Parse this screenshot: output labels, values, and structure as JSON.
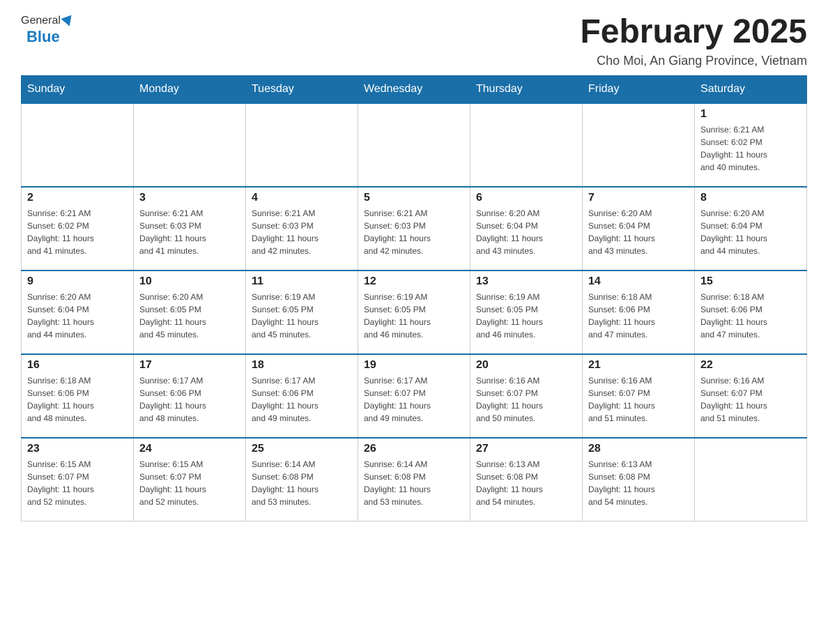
{
  "header": {
    "logo_general": "General",
    "logo_blue": "Blue",
    "month_title": "February 2025",
    "location": "Cho Moi, An Giang Province, Vietnam"
  },
  "days_of_week": [
    "Sunday",
    "Monday",
    "Tuesday",
    "Wednesday",
    "Thursday",
    "Friday",
    "Saturday"
  ],
  "weeks": [
    [
      {
        "day": "",
        "info": ""
      },
      {
        "day": "",
        "info": ""
      },
      {
        "day": "",
        "info": ""
      },
      {
        "day": "",
        "info": ""
      },
      {
        "day": "",
        "info": ""
      },
      {
        "day": "",
        "info": ""
      },
      {
        "day": "1",
        "info": "Sunrise: 6:21 AM\nSunset: 6:02 PM\nDaylight: 11 hours\nand 40 minutes."
      }
    ],
    [
      {
        "day": "2",
        "info": "Sunrise: 6:21 AM\nSunset: 6:02 PM\nDaylight: 11 hours\nand 41 minutes."
      },
      {
        "day": "3",
        "info": "Sunrise: 6:21 AM\nSunset: 6:03 PM\nDaylight: 11 hours\nand 41 minutes."
      },
      {
        "day": "4",
        "info": "Sunrise: 6:21 AM\nSunset: 6:03 PM\nDaylight: 11 hours\nand 42 minutes."
      },
      {
        "day": "5",
        "info": "Sunrise: 6:21 AM\nSunset: 6:03 PM\nDaylight: 11 hours\nand 42 minutes."
      },
      {
        "day": "6",
        "info": "Sunrise: 6:20 AM\nSunset: 6:04 PM\nDaylight: 11 hours\nand 43 minutes."
      },
      {
        "day": "7",
        "info": "Sunrise: 6:20 AM\nSunset: 6:04 PM\nDaylight: 11 hours\nand 43 minutes."
      },
      {
        "day": "8",
        "info": "Sunrise: 6:20 AM\nSunset: 6:04 PM\nDaylight: 11 hours\nand 44 minutes."
      }
    ],
    [
      {
        "day": "9",
        "info": "Sunrise: 6:20 AM\nSunset: 6:04 PM\nDaylight: 11 hours\nand 44 minutes."
      },
      {
        "day": "10",
        "info": "Sunrise: 6:20 AM\nSunset: 6:05 PM\nDaylight: 11 hours\nand 45 minutes."
      },
      {
        "day": "11",
        "info": "Sunrise: 6:19 AM\nSunset: 6:05 PM\nDaylight: 11 hours\nand 45 minutes."
      },
      {
        "day": "12",
        "info": "Sunrise: 6:19 AM\nSunset: 6:05 PM\nDaylight: 11 hours\nand 46 minutes."
      },
      {
        "day": "13",
        "info": "Sunrise: 6:19 AM\nSunset: 6:05 PM\nDaylight: 11 hours\nand 46 minutes."
      },
      {
        "day": "14",
        "info": "Sunrise: 6:18 AM\nSunset: 6:06 PM\nDaylight: 11 hours\nand 47 minutes."
      },
      {
        "day": "15",
        "info": "Sunrise: 6:18 AM\nSunset: 6:06 PM\nDaylight: 11 hours\nand 47 minutes."
      }
    ],
    [
      {
        "day": "16",
        "info": "Sunrise: 6:18 AM\nSunset: 6:06 PM\nDaylight: 11 hours\nand 48 minutes."
      },
      {
        "day": "17",
        "info": "Sunrise: 6:17 AM\nSunset: 6:06 PM\nDaylight: 11 hours\nand 48 minutes."
      },
      {
        "day": "18",
        "info": "Sunrise: 6:17 AM\nSunset: 6:06 PM\nDaylight: 11 hours\nand 49 minutes."
      },
      {
        "day": "19",
        "info": "Sunrise: 6:17 AM\nSunset: 6:07 PM\nDaylight: 11 hours\nand 49 minutes."
      },
      {
        "day": "20",
        "info": "Sunrise: 6:16 AM\nSunset: 6:07 PM\nDaylight: 11 hours\nand 50 minutes."
      },
      {
        "day": "21",
        "info": "Sunrise: 6:16 AM\nSunset: 6:07 PM\nDaylight: 11 hours\nand 51 minutes."
      },
      {
        "day": "22",
        "info": "Sunrise: 6:16 AM\nSunset: 6:07 PM\nDaylight: 11 hours\nand 51 minutes."
      }
    ],
    [
      {
        "day": "23",
        "info": "Sunrise: 6:15 AM\nSunset: 6:07 PM\nDaylight: 11 hours\nand 52 minutes."
      },
      {
        "day": "24",
        "info": "Sunrise: 6:15 AM\nSunset: 6:07 PM\nDaylight: 11 hours\nand 52 minutes."
      },
      {
        "day": "25",
        "info": "Sunrise: 6:14 AM\nSunset: 6:08 PM\nDaylight: 11 hours\nand 53 minutes."
      },
      {
        "day": "26",
        "info": "Sunrise: 6:14 AM\nSunset: 6:08 PM\nDaylight: 11 hours\nand 53 minutes."
      },
      {
        "day": "27",
        "info": "Sunrise: 6:13 AM\nSunset: 6:08 PM\nDaylight: 11 hours\nand 54 minutes."
      },
      {
        "day": "28",
        "info": "Sunrise: 6:13 AM\nSunset: 6:08 PM\nDaylight: 11 hours\nand 54 minutes."
      },
      {
        "day": "",
        "info": ""
      }
    ]
  ]
}
